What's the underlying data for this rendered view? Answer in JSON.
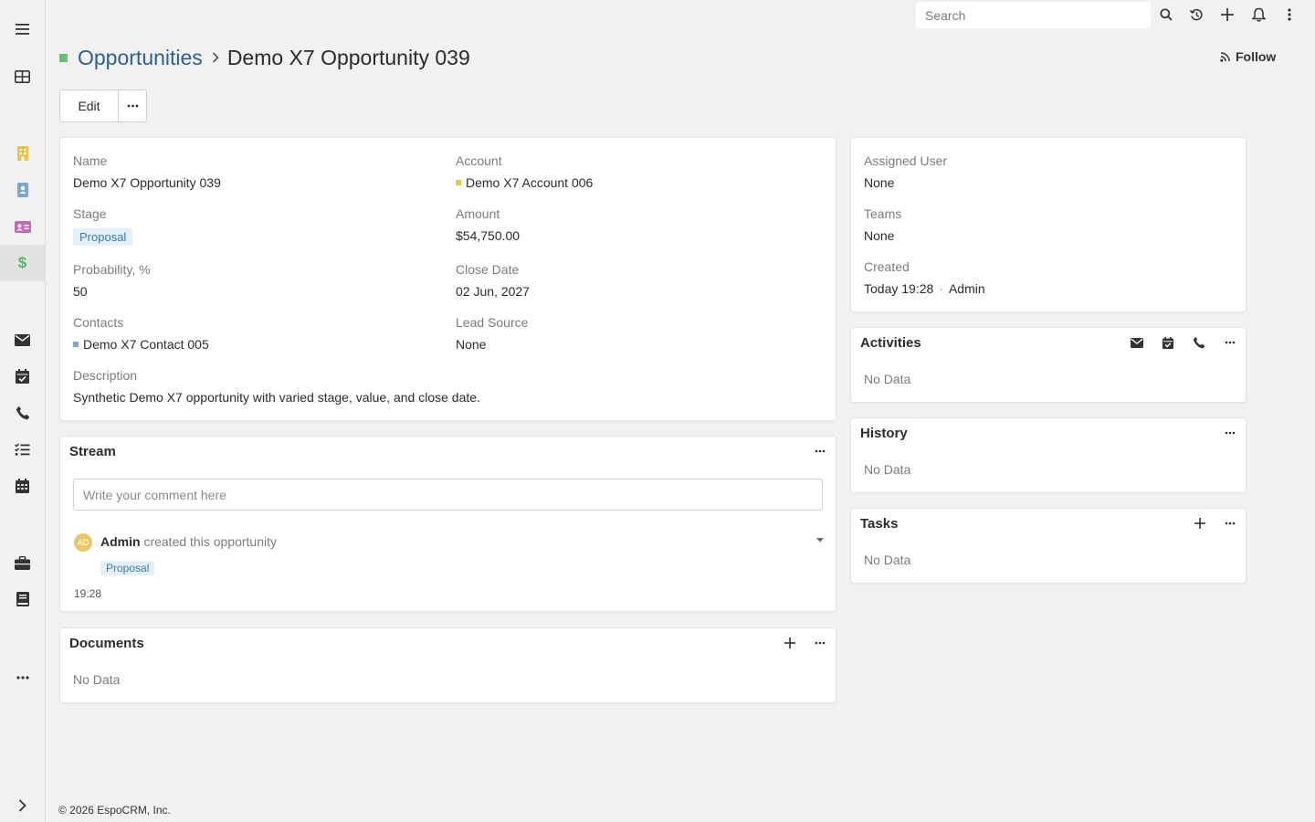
{
  "app": {
    "footer": "© 2026 EspoCRM, Inc."
  },
  "topbar": {
    "search_placeholder": "Search"
  },
  "header": {
    "breadcrumb_parent": "Opportunities",
    "breadcrumb_current": "Demo X7 Opportunity 039",
    "follow_label": "Follow",
    "edit_label": "Edit"
  },
  "details": {
    "name_label": "Name",
    "name_value": "Demo X7 Opportunity 039",
    "account_label": "Account",
    "account_value": "Demo X7 Account 006",
    "stage_label": "Stage",
    "stage_value": "Proposal",
    "amount_label": "Amount",
    "amount_value": "$54,750.00",
    "probability_label": "Probability, %",
    "probability_value": "50",
    "close_date_label": "Close Date",
    "close_date_value": "02 Jun, 2027",
    "contacts_label": "Contacts",
    "contacts_value": "Demo X7 Contact 005",
    "lead_source_label": "Lead Source",
    "lead_source_value": "None",
    "description_label": "Description",
    "description_value": "Synthetic Demo X7 opportunity with varied stage, value, and close date."
  },
  "side": {
    "assigned_user_label": "Assigned User",
    "assigned_user_value": "None",
    "teams_label": "Teams",
    "teams_value": "None",
    "created_label": "Created",
    "created_value": "Today 19:28",
    "created_sep": "·",
    "created_by": "Admin"
  },
  "stream": {
    "title": "Stream",
    "comment_placeholder": "Write your comment here",
    "avatar_initials": "AD",
    "author": "Admin",
    "action_text": " created this opportunity",
    "stage_badge": "Proposal",
    "time": "19:28"
  },
  "documents": {
    "title": "Documents",
    "empty": "No Data"
  },
  "activities": {
    "title": "Activities",
    "empty": "No Data"
  },
  "history": {
    "title": "History",
    "empty": "No Data"
  },
  "tasks": {
    "title": "Tasks",
    "empty": "No Data"
  },
  "colors": {
    "account_dot": "#e8c550",
    "contact_dot": "#7fa6cf",
    "opportunity_dot": "#6bbf73",
    "link": "#2f5f8f"
  }
}
